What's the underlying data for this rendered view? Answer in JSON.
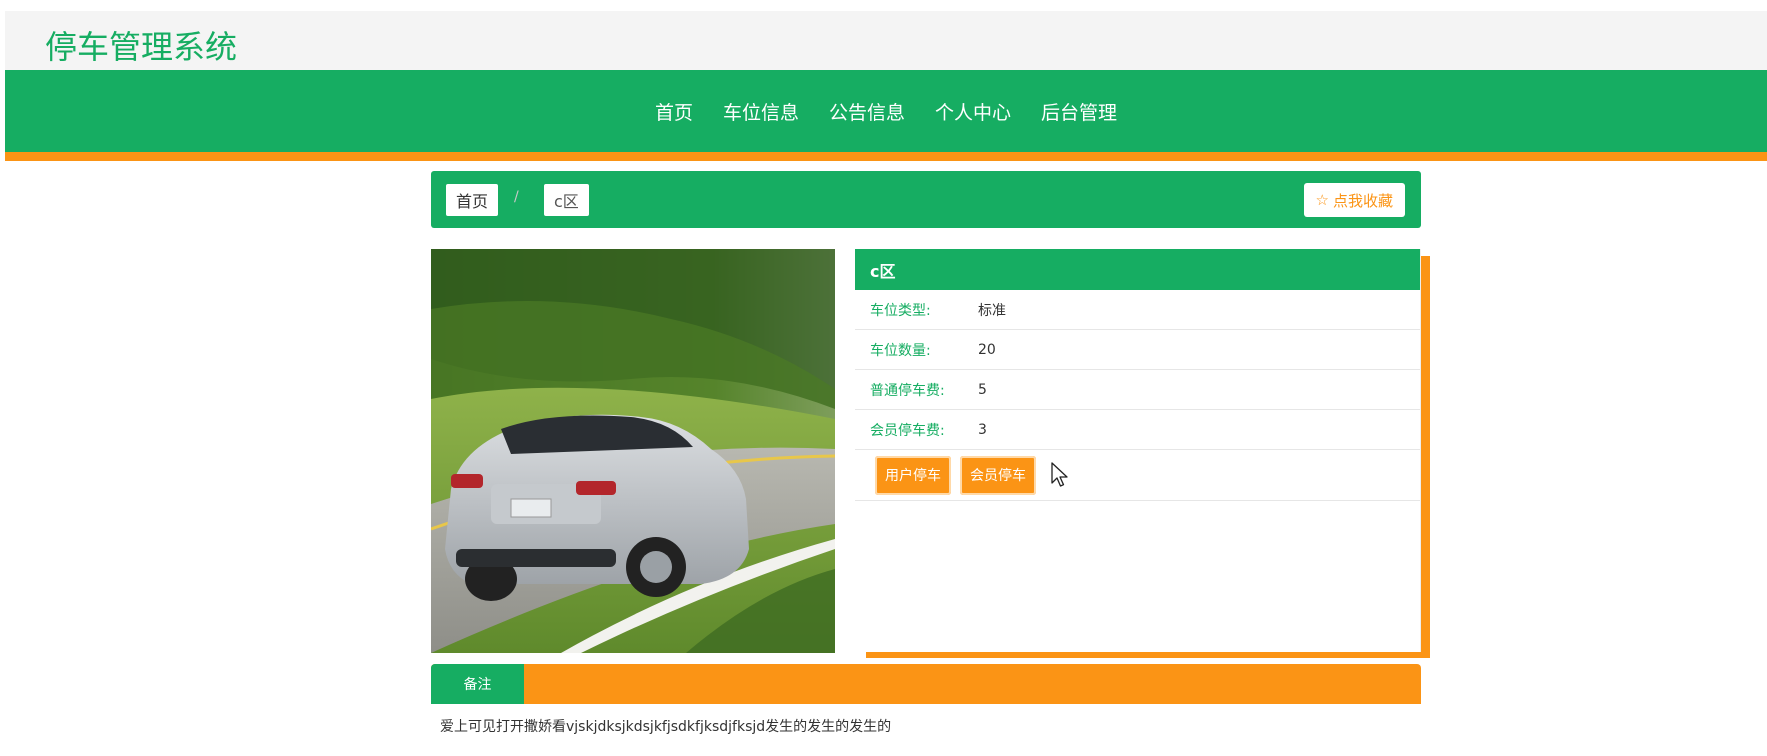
{
  "header": {
    "site_title": "停车管理系统"
  },
  "nav": {
    "items": [
      "首页",
      "车位信息",
      "公告信息",
      "个人中心",
      "后台管理"
    ]
  },
  "breadcrumb": {
    "home": "首页",
    "separator": "/",
    "current": "c区"
  },
  "favorite": {
    "icon": "star-icon",
    "label": "点我收藏"
  },
  "detail": {
    "title": "c区",
    "fields": [
      {
        "label": "车位类型:",
        "value": "标准"
      },
      {
        "label": "车位数量:",
        "value": "20"
      },
      {
        "label": "普通停车费:",
        "value": "5"
      },
      {
        "label": "会员停车费:",
        "value": "3"
      }
    ],
    "buttons": {
      "user_parking": "用户停车",
      "member_parking": "会员停车"
    }
  },
  "notes": {
    "tab_label": "备注",
    "content": "爱上可见打开撒娇看vjskjdksjkdsjkfjsdkfjksdjfksjd发生的发生的发生的"
  },
  "colors": {
    "primary": "#16ad62",
    "accent": "#fb9415"
  }
}
